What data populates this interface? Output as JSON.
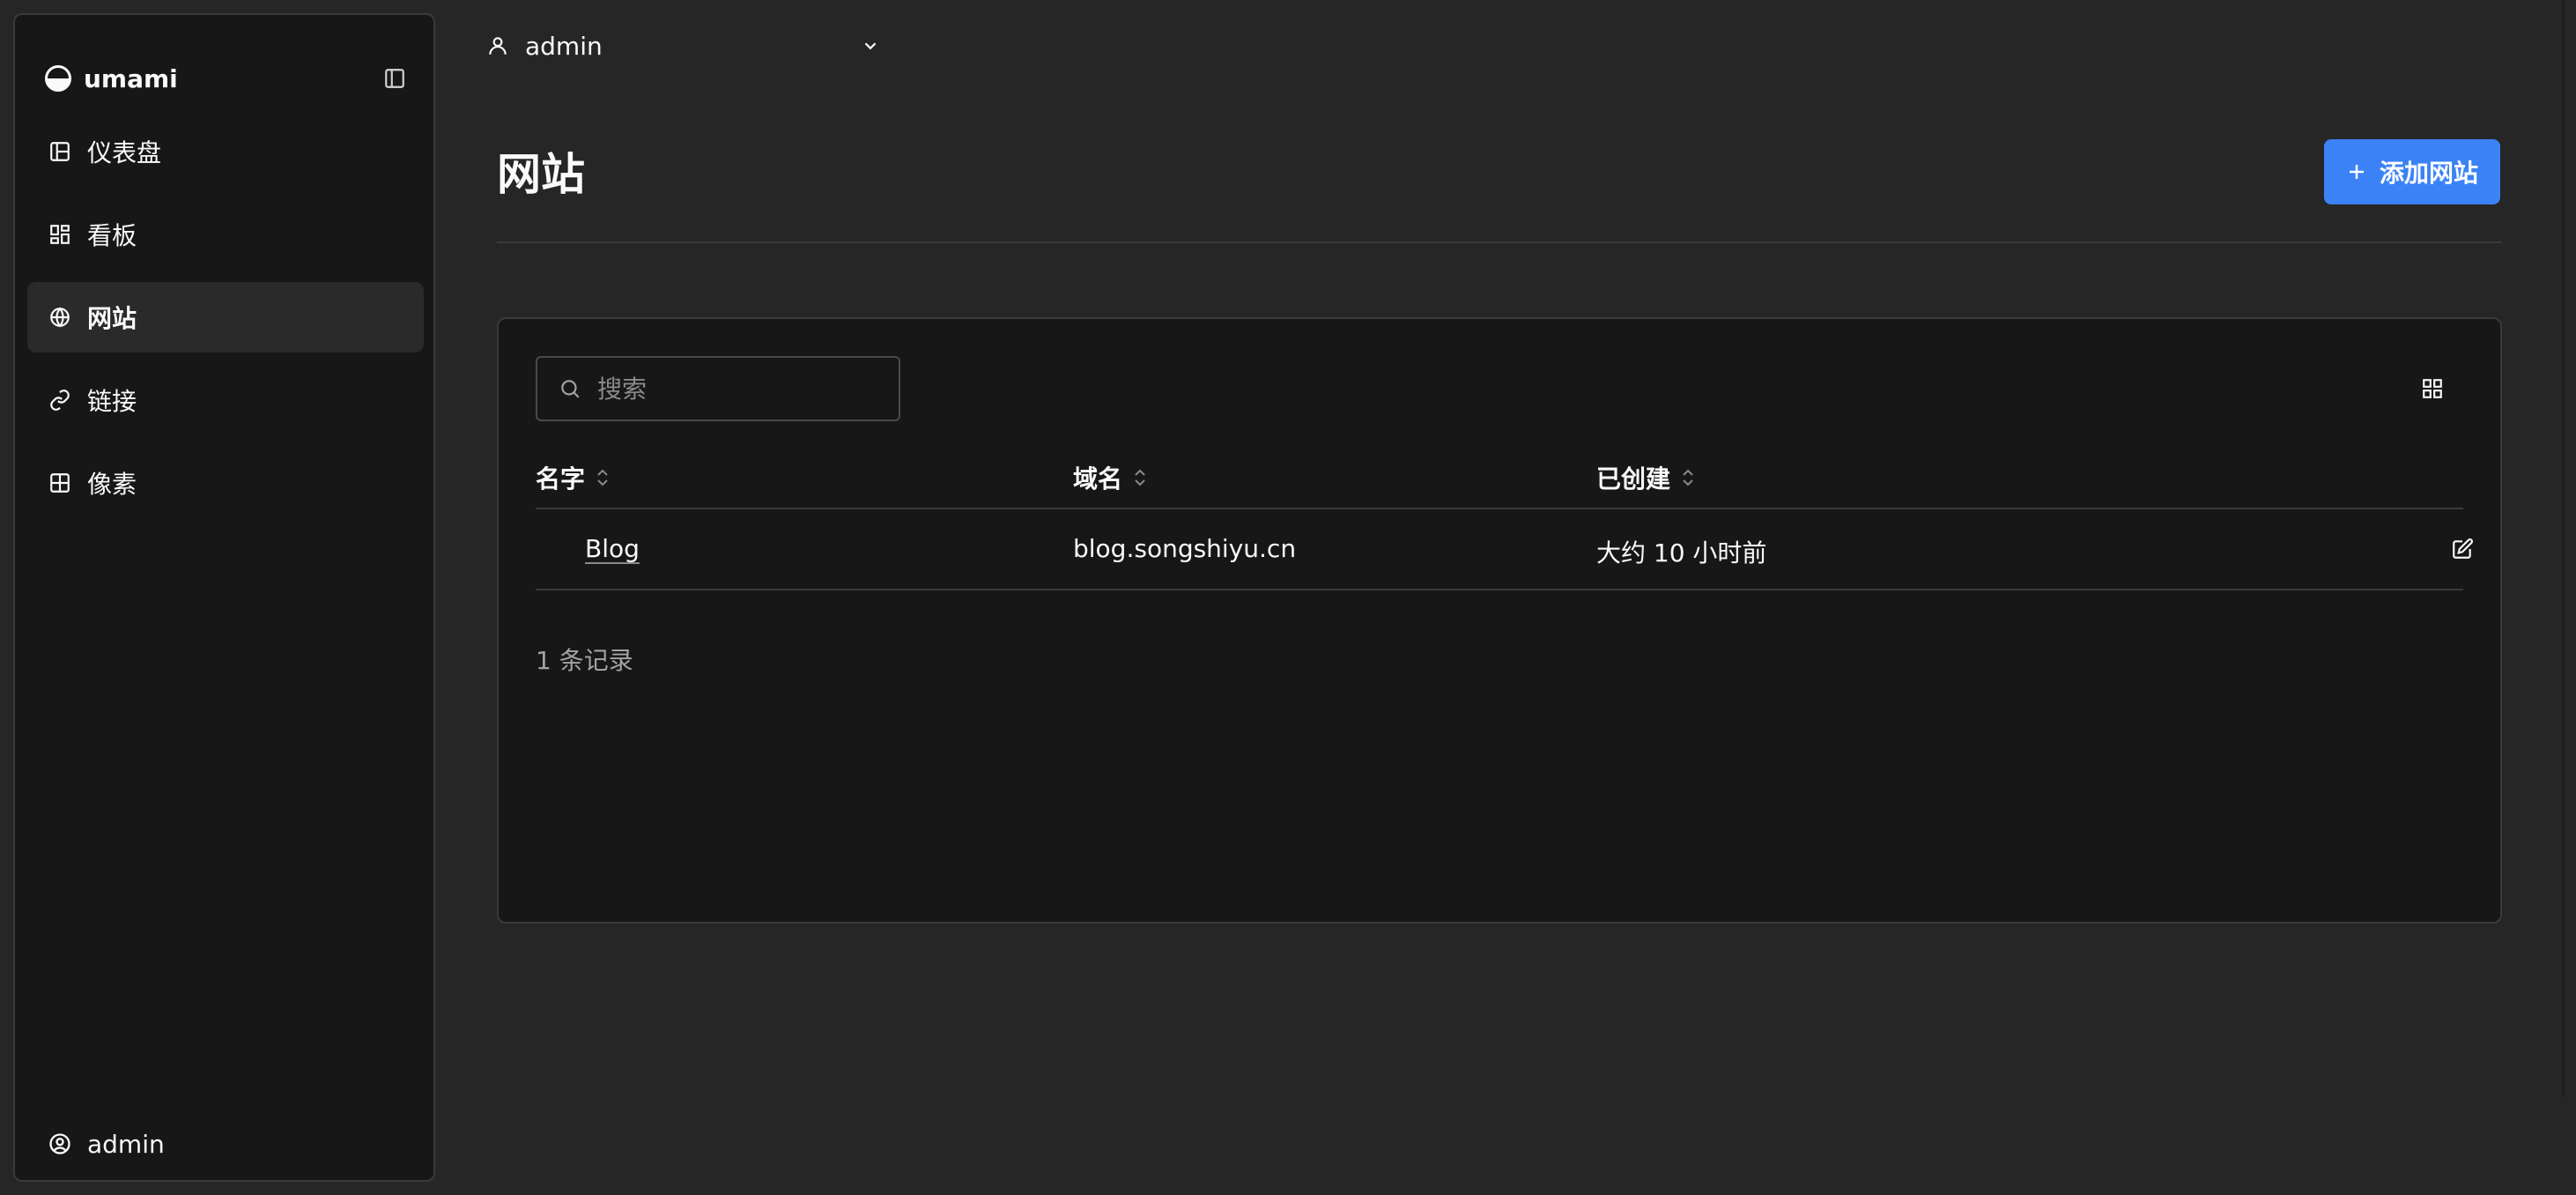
{
  "brand": {
    "name": "umami"
  },
  "sidebar": {
    "items": [
      {
        "label": "仪表盘",
        "icon": "dashboard-icon"
      },
      {
        "label": "看板",
        "icon": "boards-icon"
      },
      {
        "label": "网站",
        "icon": "globe-icon",
        "active": true
      },
      {
        "label": "链接",
        "icon": "link-icon"
      },
      {
        "label": "像素",
        "icon": "pixel-grid-icon"
      }
    ],
    "user": "admin"
  },
  "topbar": {
    "user": "admin"
  },
  "page": {
    "title": "网站",
    "add_button": "添加网站"
  },
  "search": {
    "placeholder": "搜索",
    "value": ""
  },
  "table": {
    "columns": [
      "名字",
      "域名",
      "已创建"
    ],
    "rows": [
      {
        "name": "Blog",
        "domain": "blog.songshiyu.cn",
        "created": "大约 10 小时前"
      }
    ],
    "record_count": "1 条记录"
  },
  "colors": {
    "background": "#262626",
    "panel": "#171717",
    "accent": "#3b82f6",
    "border": "#3a3a3a"
  }
}
